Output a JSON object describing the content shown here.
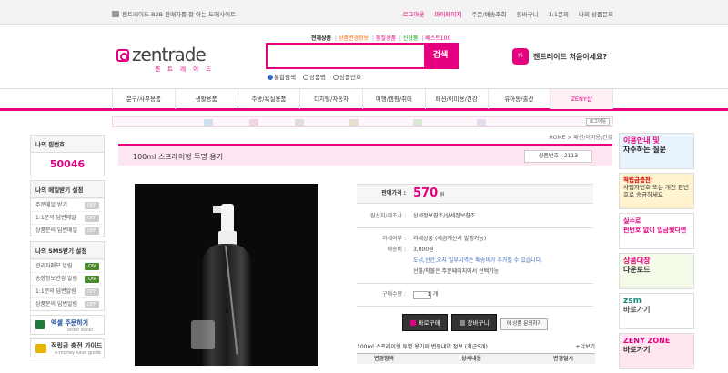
{
  "topbar": {
    "left": "젠트레이드 B2B 판매자를 잘 아는 도매사이트",
    "links": [
      "로그아웃",
      "마이페이지",
      "주문/배송조회",
      "장바구니",
      "1:1문의",
      "나의 상품문의"
    ]
  },
  "logo": {
    "text": "zentrade",
    "sub": "젠 트 레 이 드"
  },
  "search_tabs": [
    "전체상품",
    "상품변경정보",
    "품절상품",
    "신상품",
    "베스트100"
  ],
  "search": {
    "button": "검색",
    "placeholder": ""
  },
  "search_radios": [
    "통합검색",
    "상품명",
    "상품번호"
  ],
  "welcome": {
    "icon": "hi",
    "text": "젠트레이드 처음이세요?"
  },
  "nav": [
    "문구/사무용품",
    "생활용품",
    "주방/욕실용품",
    "디지털/자동차",
    "여행/캠핑/취미",
    "패션/이미용/건강",
    "유아동/출산",
    "ZENY샵"
  ],
  "strip": {
    "logout": "로그아웃"
  },
  "left": {
    "pin_title": "나의 핀번호",
    "pin": "50046",
    "mail_title": "나의 메일받기 설정",
    "mail_rows": [
      {
        "label": "주문메일 받기",
        "tag": "OFF"
      },
      {
        "label": "1:1문의 답변메일",
        "tag": "OFF"
      },
      {
        "label": "상품문의 답변메일",
        "tag": "OFF"
      }
    ],
    "sms_title": "나의 SMS받기 설정",
    "sms_rows": [
      {
        "label": "관리자메모 알림",
        "tag": "ON"
      },
      {
        "label": "송장정보변경 알림",
        "tag": "ON"
      },
      {
        "label": "1:1문의 답변알림",
        "tag": "OFF"
      },
      {
        "label": "상품문의 답변알림",
        "tag": "OFF"
      }
    ],
    "excel": {
      "title": "엑셀 주문하기",
      "sub": "order excel"
    },
    "guide": {
      "title": "적립금 충전 가이드",
      "sub": "e-money save guide"
    }
  },
  "right": [
    {
      "t1": "이용안내 및",
      "t2": "자주하는 질문"
    },
    {
      "t1": "적립금충전!",
      "t2": "사업자번호 또는 개인 핀번호로 송금하세요"
    },
    {
      "t1": "실수로",
      "t2": "핀번호 없이 입금했다면"
    },
    {
      "t1": "상품대장",
      "t2": "다운로드"
    },
    {
      "t1": "zsm",
      "t2": "바로가기"
    },
    {
      "t1": "ZENY ZONE",
      "t2": "바로가기"
    }
  ],
  "breadcrumb": "HOME > 패션/이미용/건강",
  "product": {
    "title": "100ml 스프레이형 투명 용기",
    "code": "상품번호 : 2113",
    "price_label": "판매가격 :",
    "price": "570",
    "price_unit": "원",
    "origin_label": "원산지/제조사 :",
    "origin": "상세정보참조/상세정보참조",
    "tax_label": "과세여부 :",
    "tax": "과세상품 (세금계산서 발행가능)",
    "ship_label": "배송비 :",
    "ship": "3,000원",
    "ship_note1": "도서,산간,오지 일부지역은 배송비가 추가될 수 있습니다.",
    "ship_note2": "선불/착불은 주문페이지에서 선택가능",
    "qty_label": "구매수량 :",
    "qty": "1",
    "qty_unit": "개",
    "buy": "바로구매",
    "cart": "장바구니",
    "ask": "이 상품 문의하기",
    "hist_title": "100ml 스프레이형 투명 용기의 변동내역 정보 (최근5개)",
    "hist_more": "+더보기",
    "hist_cols": [
      "변경항목",
      "상세내용",
      "변경일시"
    ]
  }
}
